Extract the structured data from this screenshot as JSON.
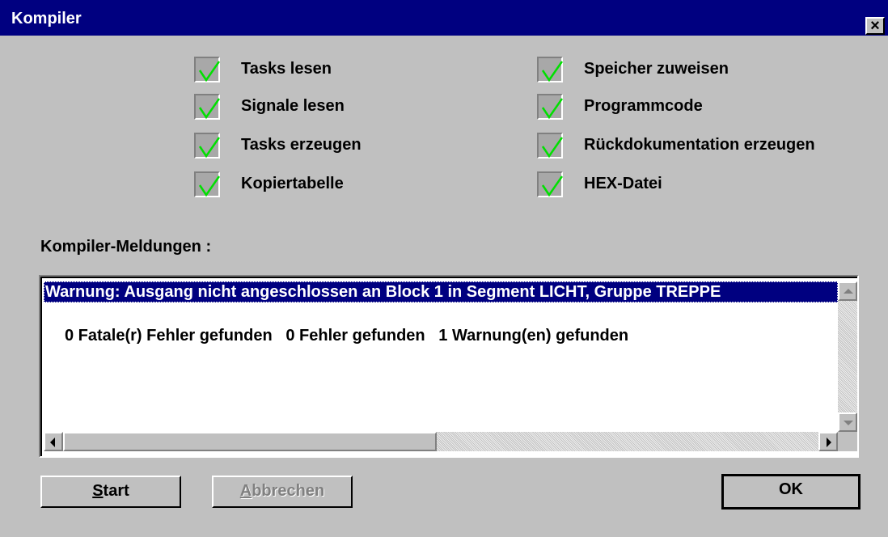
{
  "window": {
    "title": "Kompiler",
    "close_label": "×"
  },
  "steps_left": [
    {
      "label": "Tasks lesen",
      "checked": true
    },
    {
      "label": "Signale lesen",
      "checked": true
    },
    {
      "label": "Tasks erzeugen",
      "checked": true
    },
    {
      "label": "Kopiertabelle",
      "checked": true
    }
  ],
  "steps_right": [
    {
      "label": "Speicher zuweisen",
      "checked": true
    },
    {
      "label": "Programmcode",
      "checked": true
    },
    {
      "label": "Rückdokumentation erzeugen",
      "checked": true
    },
    {
      "label": "HEX-Datei",
      "checked": true
    }
  ],
  "messages": {
    "label": "Kompiler-Meldungen :",
    "selected_line": "Warnung: Ausgang nicht angeschlossen an Block 1 in Segment LICHT, Gruppe TREPPE",
    "summary_line": "0 Fatale(r) Fehler gefunden   0 Fehler gefunden   1 Warnung(en) gefunden"
  },
  "buttons": {
    "start_mnemonic": "S",
    "start_rest": "tart",
    "cancel_mnemonic": "A",
    "cancel_rest": "bbrechen",
    "cancel_enabled": false,
    "ok_label": "OK"
  },
  "colors": {
    "titlebar": "#000080",
    "check": "#00e000",
    "face": "#c0c0c0",
    "selection": "#000080"
  }
}
